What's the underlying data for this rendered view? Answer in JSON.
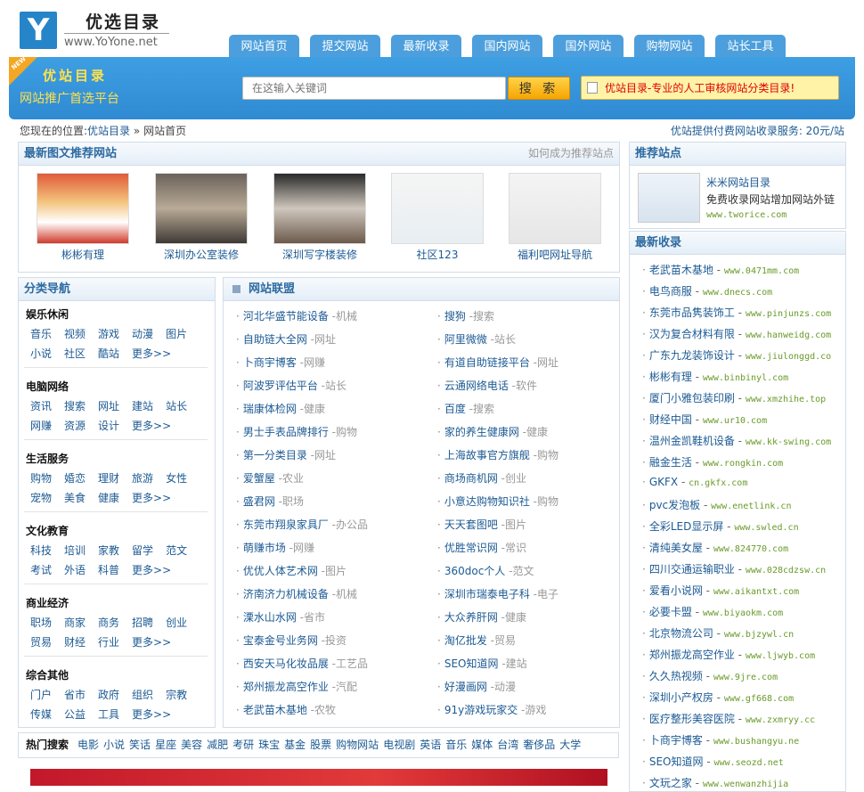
{
  "logo": {
    "letter": "Y",
    "title": "优选目录",
    "url": "www.YoYone.net"
  },
  "nav": [
    "网站首页",
    "提交网站",
    "最新收录",
    "国内网站",
    "国外网站",
    "购物网站",
    "站长工具"
  ],
  "banner": {
    "new": "NEW",
    "title": "优站目录",
    "subtitle": "网站推广首选平台",
    "search_placeholder": "在这输入关键词",
    "search_button": "搜 索",
    "notice": "优站目录-专业的人工审核网站分类目录!"
  },
  "breadcrumb": {
    "prefix": "您现在的位置:",
    "home": "优站目录",
    "sep": "»",
    "current": "网站首页"
  },
  "service": "优站提供付费网站收录服务: 20元/站",
  "featured": {
    "title": "最新图文推荐网站",
    "more": "如何成为推荐站点",
    "items": [
      "彬彬有理",
      "深圳办公室装修",
      "深圳写字楼装修",
      "社区123",
      "福利吧网址导航"
    ]
  },
  "categories": {
    "title": "分类导航",
    "groups": [
      {
        "title": "娱乐休闲",
        "rows": [
          [
            "音乐",
            "视频",
            "游戏",
            "动漫",
            "图片"
          ],
          [
            "小说",
            "社区",
            "酷站",
            "更多>>"
          ]
        ]
      },
      {
        "title": "电脑网络",
        "rows": [
          [
            "资讯",
            "搜索",
            "网址",
            "建站",
            "站长"
          ],
          [
            "网赚",
            "资源",
            "设计",
            "更多>>"
          ]
        ]
      },
      {
        "title": "生活服务",
        "rows": [
          [
            "购物",
            "婚恋",
            "理财",
            "旅游",
            "女性"
          ],
          [
            "宠物",
            "美食",
            "健康",
            "更多>>"
          ]
        ]
      },
      {
        "title": "文化教育",
        "rows": [
          [
            "科技",
            "培训",
            "家教",
            "留学",
            "范文"
          ],
          [
            "考试",
            "外语",
            "科普",
            "更多>>"
          ]
        ]
      },
      {
        "title": "商业经济",
        "rows": [
          [
            "职场",
            "商家",
            "商务",
            "招聘",
            "创业"
          ],
          [
            "贸易",
            "财经",
            "行业",
            "更多>>"
          ]
        ]
      },
      {
        "title": "综合其他",
        "rows": [
          [
            "门户",
            "省市",
            "政府",
            "组织",
            "宗教"
          ],
          [
            "传媒",
            "公益",
            "工具",
            "更多>>"
          ]
        ]
      }
    ]
  },
  "links": {
    "title": "网站联盟",
    "items": [
      {
        "name": "河北华盛节能设备",
        "tag": "-机械"
      },
      {
        "name": "搜狗",
        "tag": "-搜索"
      },
      {
        "name": "自助链大全网",
        "tag": "-网址"
      },
      {
        "name": "阿里微微",
        "tag": "-站长"
      },
      {
        "name": "卜商宇博客",
        "tag": "-网赚"
      },
      {
        "name": "有道自助链接平台",
        "tag": "-网址"
      },
      {
        "name": "阿波罗评估平台",
        "tag": "-站长"
      },
      {
        "name": "云通网络电话",
        "tag": "-软件"
      },
      {
        "name": "瑞康体检网",
        "tag": "-健康"
      },
      {
        "name": "百度",
        "tag": "-搜索"
      },
      {
        "name": "男士手表品牌排行",
        "tag": "-购物"
      },
      {
        "name": "家的养生健康网",
        "tag": "-健康"
      },
      {
        "name": "第一分类目录",
        "tag": "-网址"
      },
      {
        "name": "上海故事官方旗舰",
        "tag": "-购物"
      },
      {
        "name": "爱蟹屋",
        "tag": "-农业"
      },
      {
        "name": "商场商机网",
        "tag": "-创业"
      },
      {
        "name": "盛君网",
        "tag": "-职场"
      },
      {
        "name": "小意达购物知识社",
        "tag": "-购物"
      },
      {
        "name": "东莞市翔泉家具厂",
        "tag": "-办公品"
      },
      {
        "name": "天天套图吧",
        "tag": "-图片"
      },
      {
        "name": "萌赚市场",
        "tag": "-网赚"
      },
      {
        "name": "优胜常识网",
        "tag": "-常识"
      },
      {
        "name": "优优人体艺术网",
        "tag": "-图片"
      },
      {
        "name": "360doc个人",
        "tag": "-范文"
      },
      {
        "name": "济南济力机械设备",
        "tag": "-机械"
      },
      {
        "name": "深圳市瑞泰电子科",
        "tag": "-电子"
      },
      {
        "name": "溧水山水网",
        "tag": "-省市"
      },
      {
        "name": "大众养肝网",
        "tag": "-健康"
      },
      {
        "name": "宝泰金号业务网",
        "tag": "-投资"
      },
      {
        "name": "淘亿批发",
        "tag": "-贸易"
      },
      {
        "name": "西安天马化妆品展",
        "tag": "-工艺品"
      },
      {
        "name": "SEO知道网",
        "tag": "-建站"
      },
      {
        "name": "郑州振龙高空作业",
        "tag": "-汽配"
      },
      {
        "name": "好漫画网",
        "tag": "-动漫"
      },
      {
        "name": "老武苗木基地",
        "tag": "-农牧"
      },
      {
        "name": "91y游戏玩家交",
        "tag": "-游戏"
      }
    ]
  },
  "hot": {
    "label": "热门搜索",
    "items": [
      "电影",
      "小说",
      "笑话",
      "星座",
      "美容",
      "减肥",
      "考研",
      "珠宝",
      "基金",
      "股票",
      "购物网站",
      "电视剧",
      "英语",
      "音乐",
      "媒体",
      "台湾",
      "奢侈品",
      "大学"
    ]
  },
  "recommend": {
    "title": "推荐站点",
    "name": "米米网站目录",
    "desc": "免费收录网站增加网站外链",
    "url": "www.tworice.com"
  },
  "latest": {
    "title": "最新收录",
    "items": [
      {
        "name": "老武苗木基地",
        "url": "www.0471mm.com"
      },
      {
        "name": "电鸟商服",
        "url": "www.dnecs.com"
      },
      {
        "name": "东莞市品隽装饰工",
        "url": "www.pinjunzs.com"
      },
      {
        "name": "汉为复合材料有限",
        "url": "www.hanweidg.com"
      },
      {
        "name": "广东九龙装饰设计",
        "url": "www.jiulonggd.co"
      },
      {
        "name": "彬彬有理",
        "url": "www.binbinyl.com"
      },
      {
        "name": "厦门小雅包装印刷",
        "url": "www.xmzhihe.top"
      },
      {
        "name": "财经中国",
        "url": "www.ur10.com"
      },
      {
        "name": "温州金凯鞋机设备",
        "url": "www.kk-swing.com"
      },
      {
        "name": "融金生活",
        "url": "www.rongkin.com"
      },
      {
        "name": "GKFX",
        "url": "cn.gkfx.com"
      },
      {
        "name": "pvc发泡板",
        "url": "www.enetlink.cn"
      },
      {
        "name": "全彩LED显示屏",
        "url": "www.swled.cn"
      },
      {
        "name": "清纯美女屋",
        "url": "www.824770.com"
      },
      {
        "name": "四川交通运输职业",
        "url": "www.028cdzsw.cn"
      },
      {
        "name": "爱看小说网",
        "url": "www.aikantxt.com"
      },
      {
        "name": "必要卡盟",
        "url": "www.biyaokm.com"
      },
      {
        "name": "北京物流公司",
        "url": "www.bjzywl.cn"
      },
      {
        "name": "郑州振龙高空作业",
        "url": "www.ljwyb.com"
      },
      {
        "name": "久久热视频",
        "url": "www.9jre.com"
      },
      {
        "name": "深圳小产权房",
        "url": "www.gf668.com"
      },
      {
        "name": "医疗整形美容医院",
        "url": "www.zxmryy.cc"
      },
      {
        "name": "卜商宇博客",
        "url": "www.bushangyu.ne"
      },
      {
        "name": "SEO知道网",
        "url": "www.seozd.net"
      },
      {
        "name": "文玩之家",
        "url": "www.wenwanzhijia"
      }
    ]
  },
  "colors": {
    "nav": "#4c9fdc",
    "banner": "#2f8ad2",
    "link": "#1c5a93",
    "url": "#6a9a2a",
    "accent": "#f6a400"
  }
}
